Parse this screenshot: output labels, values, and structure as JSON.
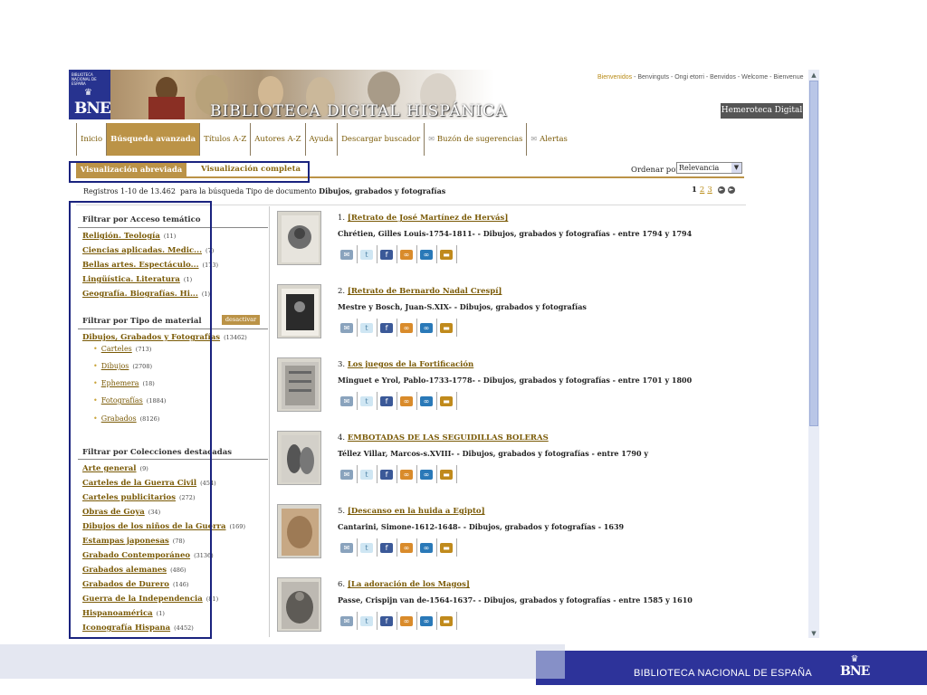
{
  "header": {
    "logo_small_text": "BIBLIOTECA NACIONAL DE ESPAÑA",
    "logo_text": "BNE",
    "title": "BIBLIOTECA DIGITAL HISPÁNICA",
    "languages_first": "Bienvenidos",
    "languages_rest": " - Benvinguts - Ongi etorri - Benvidos - Welcome - Bienvenue",
    "hemeroteca": "Hemeroteca Digital"
  },
  "nav": {
    "items": [
      "Inicio",
      "Búsqueda avanzada",
      "Títulos A-Z",
      "Autores A-Z",
      "Ayuda",
      "Descargar buscador",
      "Buzón de sugerencias",
      "Alertas"
    ]
  },
  "tabs": {
    "abreviada": "Visualización abreviada",
    "completa": "Visualización completa"
  },
  "sort": {
    "label": "Ordenar por:",
    "value": "Relevancia"
  },
  "results_info": {
    "prefix": "Registros 1-10 de 13.462",
    "middle": "para la búsqueda Tipo de documento",
    "query": "Dibujos, grabados y fotografías"
  },
  "pagination": {
    "current": "1",
    "pages": [
      "2",
      "3"
    ]
  },
  "sidebar": {
    "tematico_heading": "Filtrar por Acceso temático",
    "tematico": [
      {
        "label": "Religión. Teología",
        "count": "(11)"
      },
      {
        "label": "Ciencias aplicadas. Medic...",
        "count": "(7)"
      },
      {
        "label": "Bellas artes. Espectáculo...",
        "count": "(173)"
      },
      {
        "label": "Lingüística. Literatura",
        "count": "(1)"
      },
      {
        "label": "Geografía. Biografías. Hi...",
        "count": "(1)"
      }
    ],
    "material_heading": "Filtrar por Tipo de material",
    "desactivar": "desactivar",
    "material_main": {
      "label": "Dibujos, Grabados y Fotografías",
      "count": "(13462)"
    },
    "material_sub": [
      {
        "label": "Carteles",
        "count": "(713)"
      },
      {
        "label": "Dibujos",
        "count": "(2708)"
      },
      {
        "label": "Ephemera",
        "count": "(18)"
      },
      {
        "label": "Fotografías",
        "count": "(1884)"
      },
      {
        "label": "Grabados",
        "count": "(8126)"
      }
    ],
    "colecciones_heading": "Filtrar por Colecciones destacadas",
    "colecciones": [
      {
        "label": "Arte general",
        "count": "(9)"
      },
      {
        "label": "Carteles de la Guerra Civil",
        "count": "(454)"
      },
      {
        "label": "Carteles publicitarios",
        "count": "(272)"
      },
      {
        "label": "Obras de Goya",
        "count": "(34)"
      },
      {
        "label": "Dibujos de los niños de la Guerra",
        "count": "(169)"
      },
      {
        "label": "Estampas japonesas",
        "count": "(78)"
      },
      {
        "label": "Grabado Contemporáneo",
        "count": "(3136)"
      },
      {
        "label": "Grabados alemanes",
        "count": "(486)"
      },
      {
        "label": "Grabados de Durero",
        "count": "(146)"
      },
      {
        "label": "Guerra de la Independencia",
        "count": "(81)"
      },
      {
        "label": "Hispanoamérica",
        "count": "(1)"
      },
      {
        "label": "Iconografía Hispana",
        "count": "(4452)"
      }
    ]
  },
  "results": [
    {
      "num": "1.",
      "title": "[Retrato de José Martínez de Hervás]",
      "meta": "Chrétien, Gilles Louis-1754-1811-  -  Dibujos, grabados y fotografías  -  entre 1794 y 1794"
    },
    {
      "num": "2.",
      "title": "[Retrato de Bernardo Nadal Crespí]",
      "meta": "Mestre y Bosch, Juan-S.XIX-  -  Dibujos, grabados y fotografías"
    },
    {
      "num": "3.",
      "title": "Los juegos de la Fortificación",
      "meta": "Minguet e Yrol, Pablo-1733-1778-  -  Dibujos, grabados y fotografías  -  entre 1701 y 1800"
    },
    {
      "num": "4.",
      "title": "EMBOTADAS DE LAS SEGUIDILLAS BOLERAS",
      "meta": "Téllez Villar, Marcos-s.XVIII-  -  Dibujos, grabados y fotografías  -  entre 1790 y"
    },
    {
      "num": "5.",
      "title": "[Descanso en la huida a Egipto]",
      "meta": "Cantarini, Simone-1612-1648-  -  Dibujos, grabados y fotografías  -  1639"
    },
    {
      "num": "6.",
      "title": "[La adoración de los Magos]",
      "meta": "Passe, Crispijn van de-1564-1637-  -  Dibujos, grabados y fotografías  -  entre 1585 y 1610"
    }
  ],
  "footer": {
    "text": "BIBLIOTECA NACIONAL DE ESPAÑA",
    "logo": "BNE"
  }
}
